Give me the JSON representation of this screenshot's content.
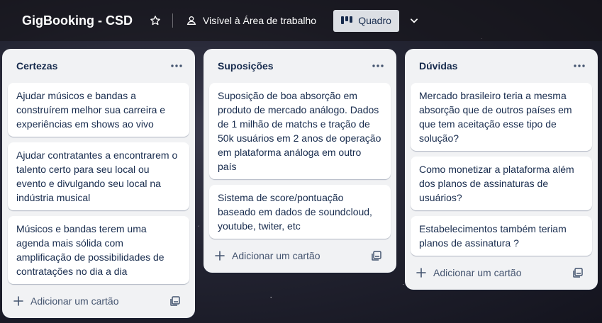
{
  "header": {
    "board_title": "GigBooking - CSD",
    "visibility_label": "Visível à Área de trabalho",
    "view_label": "Quadro"
  },
  "lists": [
    {
      "title": "Certezas",
      "cards": [
        "Ajudar músicos e bandas a construírem melhor sua carreira e experiências em shows ao vivo",
        "Ajudar contratantes a encontrarem o talento certo para seu local ou evento e divulgando seu local na indústria musical",
        "Músicos e bandas terem uma agenda mais sólida com amplificação de possibilidades de contratações no dia a dia"
      ],
      "add_label": "Adicionar um cartão"
    },
    {
      "title": "Suposições",
      "cards": [
        "Suposição de boa absorção em produto de mercado análogo. Dados de 1 milhão de matchs e tração de 50k usuários em 2 anos de operação em plataforma análoga em outro país",
        "Sistema de score/pontuação baseado em dados de soundcloud, youtube, twiter, etc"
      ],
      "add_label": "Adicionar um cartão"
    },
    {
      "title": "Dúvidas",
      "cards": [
        "Mercado brasileiro teria a mesma absorção que de outros países em que tem aceitação esse tipo de solução?",
        "Como monetizar a plataforma além dos planos de assinaturas de usuários?",
        "Estabelecimentos também teriam planos de assinatura ?"
      ],
      "add_label": "Adicionar um cartão"
    }
  ],
  "icons": {
    "star": "star-icon",
    "visibility": "people-icon",
    "board_view": "board-icon",
    "view_dropdown": "chevron-down-icon",
    "list_menu": "more-horizontal-icon",
    "add": "plus-icon",
    "template": "template-icon"
  },
  "colors": {
    "list_bg": "#f1f2f4",
    "card_bg": "#ffffff",
    "text": "#172b4d",
    "active_view_bg": "#dcdfe4"
  }
}
